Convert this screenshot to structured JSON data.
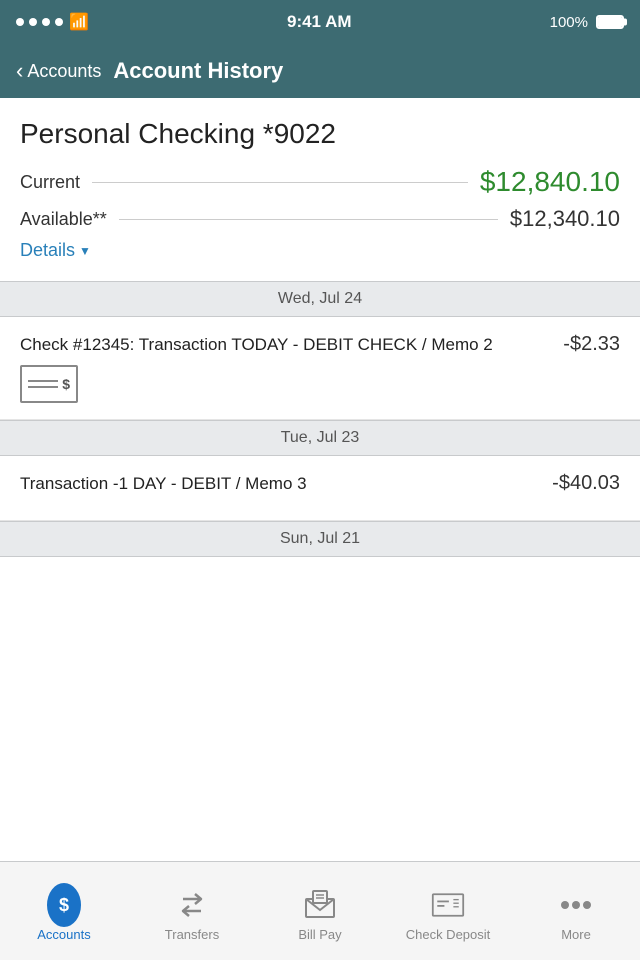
{
  "status_bar": {
    "time": "9:41 AM",
    "battery": "100%",
    "dots": 4
  },
  "nav": {
    "back_label": "Accounts",
    "title": "Account History"
  },
  "account": {
    "name": "Personal Checking *9022",
    "current_label": "Current",
    "current_value": "$12,840.10",
    "available_label": "Available**",
    "available_value": "$12,340.10",
    "details_label": "Details"
  },
  "sections": [
    {
      "date": "Wed, Jul 24",
      "transactions": [
        {
          "description": "Check #12345: Transaction TODAY - DEBIT CHECK / Memo 2",
          "amount": "-$2.33",
          "has_check_icon": true
        }
      ]
    },
    {
      "date": "Tue, Jul 23",
      "transactions": [
        {
          "description": "Transaction -1 DAY - DEBIT / Memo 3",
          "amount": "-$40.03",
          "has_check_icon": false
        }
      ]
    },
    {
      "date": "Sun, Jul 21",
      "transactions": []
    }
  ],
  "tab_bar": {
    "items": [
      {
        "id": "accounts",
        "label": "Accounts",
        "active": true
      },
      {
        "id": "transfers",
        "label": "Transfers",
        "active": false
      },
      {
        "id": "bill-pay",
        "label": "Bill Pay",
        "active": false
      },
      {
        "id": "check-deposit",
        "label": "Check Deposit",
        "active": false
      },
      {
        "id": "more",
        "label": "More",
        "active": false
      }
    ]
  }
}
